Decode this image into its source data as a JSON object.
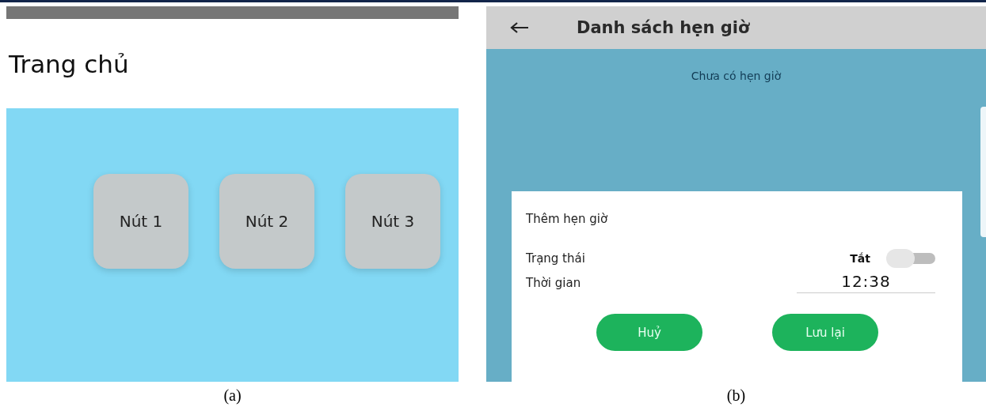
{
  "panels": [
    {
      "caption": "(a)",
      "screen": {
        "kind": "home",
        "title": "Trang chủ",
        "buttons": [
          "Nút 1",
          "Nút 2",
          "Nút 3"
        ]
      }
    },
    {
      "caption": "(b)",
      "screen": {
        "kind": "timers",
        "title": "Danh sách hẹn giờ",
        "empty_message": "Chưa có hẹn giờ",
        "dialog": {
          "title": "Thêm hẹn giờ",
          "status_label": "Trạng thái",
          "status_text": "Tắt",
          "status_on": false,
          "time_label": "Thời gian",
          "time_value": "12:38",
          "buttons": [
            "Huỷ",
            "Lưu lại"
          ]
        }
      }
    }
  ]
}
